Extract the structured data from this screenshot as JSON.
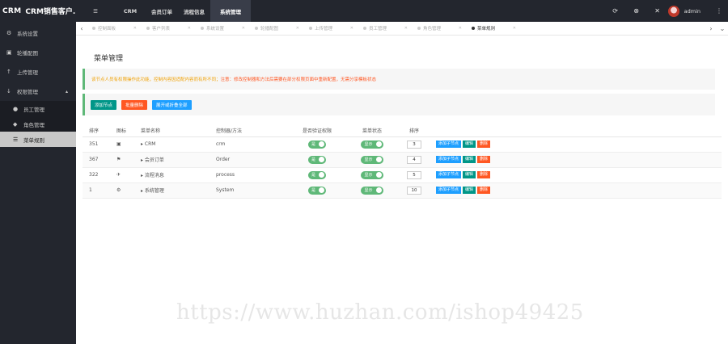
{
  "app": {
    "logo": "CRM",
    "title": "CRM销售客户..."
  },
  "topnav": [
    {
      "label": "☰",
      "name": "menu-toggle-icon"
    },
    {
      "label": "CRM",
      "name": "topnav-crm"
    },
    {
      "label": "会员订单",
      "name": "topnav-orders"
    },
    {
      "label": "流程信息",
      "name": "topnav-process"
    },
    {
      "label": "系统管理",
      "name": "topnav-system",
      "active": true
    }
  ],
  "user": {
    "name": "admin"
  },
  "sidebar": {
    "items": [
      {
        "label": "系统设置",
        "icon": "gear-icon"
      },
      {
        "label": "轮播配图",
        "icon": "image-icon"
      },
      {
        "label": "上传管理",
        "icon": "upload-icon"
      },
      {
        "label": "权限管理",
        "icon": "download-icon"
      }
    ],
    "subitems": [
      {
        "label": "员工管理",
        "icon": "user-icon"
      },
      {
        "label": "角色管理",
        "icon": "users-icon"
      },
      {
        "label": "菜单规则",
        "icon": "menu-icon",
        "active": true
      }
    ]
  },
  "tabs": [
    "控制面板",
    "客户列表",
    "系统设置",
    "轮播配图",
    "上传管理",
    "员工管理",
    "角色管理",
    "菜单规则"
  ],
  "page": {
    "title": "菜单管理",
    "notice_tip": "该节点人员有权限操作此功能，控制内容因适配内容而有所不同；",
    "notice_warn": "注意：修改控制器和方法后需要在部分权限页面中重新配置，无需分享模板状态",
    "buttons": {
      "add": "添加节点",
      "delete": "批量删除",
      "expand": "展开或折叠全部"
    }
  },
  "table": {
    "headers": [
      "排序",
      "图标",
      "菜单名称",
      "控制器/方法",
      "是否验证权限",
      "菜单状态",
      "排序"
    ],
    "header_ids": [
      "id",
      "icon",
      "name",
      "controller",
      "auth",
      "status",
      "sort"
    ],
    "rows": [
      {
        "id": "351",
        "icon": "▣",
        "name": "▸ CRM",
        "controller": "crm",
        "auth": "是",
        "status": "显示",
        "sort": "3"
      },
      {
        "id": "367",
        "icon": "⚑",
        "name": "▸ 会员订单",
        "controller": "Order",
        "auth": "是",
        "status": "显示",
        "sort": "4"
      },
      {
        "id": "322",
        "icon": "✈",
        "name": "▸ 流程消息",
        "controller": "process",
        "auth": "是",
        "status": "显示",
        "sort": "5"
      },
      {
        "id": "1",
        "icon": "⚙",
        "name": "▸ 系统管理",
        "controller": "System",
        "auth": "是",
        "status": "显示",
        "sort": "10"
      }
    ],
    "actions": {
      "add_child": "添加子节点",
      "edit": "编辑",
      "delete": "删除"
    }
  },
  "colors": {
    "dark": "#23262e",
    "green": "#009688",
    "red": "#ff5722",
    "blue": "#1e9fff",
    "switch": "#5fb878"
  },
  "watermark": "https://www.huzhan.com/ishop49425"
}
